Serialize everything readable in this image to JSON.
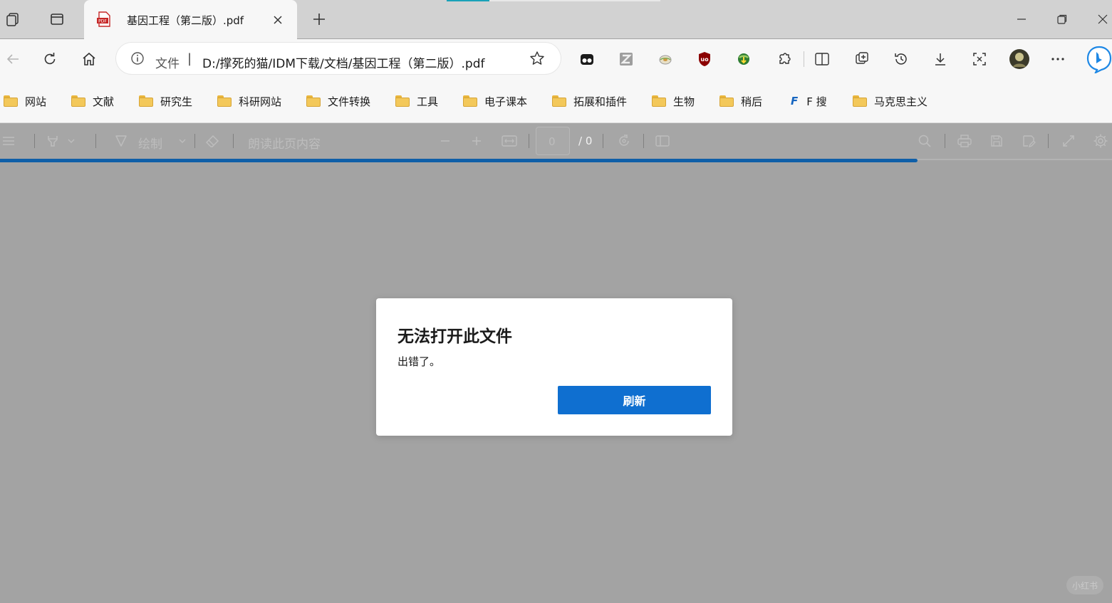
{
  "tab": {
    "title": "基因工程（第二版）.pdf",
    "favicon": "PDF"
  },
  "address_bar": {
    "scheme_label": "文件",
    "separator": "|",
    "url": "D:/撑死的猫/IDM下载/文档/基因工程（第二版）.pdf"
  },
  "bookmarks": [
    {
      "label": "网站",
      "icon": "folder-icon"
    },
    {
      "label": "文献",
      "icon": "folder-icon"
    },
    {
      "label": "研究生",
      "icon": "folder-icon"
    },
    {
      "label": "科研网站",
      "icon": "folder-icon"
    },
    {
      "label": "文件转换",
      "icon": "folder-icon"
    },
    {
      "label": "工具",
      "icon": "folder-icon"
    },
    {
      "label": "电子课本",
      "icon": "folder-icon"
    },
    {
      "label": "拓展和插件",
      "icon": "folder-icon"
    },
    {
      "label": "生物",
      "icon": "folder-icon"
    },
    {
      "label": "稍后",
      "icon": "folder-icon"
    },
    {
      "label": "F 搜",
      "icon": "f-search-icon",
      "icon_text": "F"
    },
    {
      "label": "马克思主义",
      "icon": "folder-icon"
    }
  ],
  "pdf_toolbar": {
    "draw_label": "绘制",
    "read_aloud_label": "朗读此页内容",
    "page_value": "0",
    "page_total": "/ 0"
  },
  "dialog": {
    "title": "无法打开此文件",
    "message": "出错了。",
    "button": "刷新"
  },
  "watermark": "小红书",
  "colors": {
    "accent": "#0f6fd0",
    "progress": "#0f5fa8",
    "overlay": "#a3a3a3"
  }
}
